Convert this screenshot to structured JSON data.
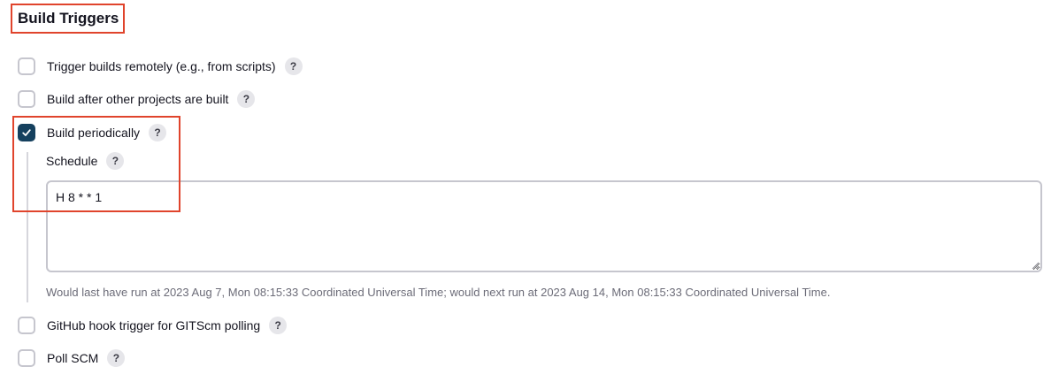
{
  "section": {
    "title": "Build Triggers"
  },
  "triggers": [
    {
      "label": "Trigger builds remotely (e.g., from scripts)",
      "checked": false,
      "help": "?"
    },
    {
      "label": "Build after other projects are built",
      "checked": false,
      "help": "?"
    },
    {
      "label": "Build periodically",
      "checked": true,
      "help": "?"
    },
    {
      "label": "GitHub hook trigger for GITScm polling",
      "checked": false,
      "help": "?"
    },
    {
      "label": "Poll SCM",
      "checked": false,
      "help": "?"
    }
  ],
  "schedule": {
    "label": "Schedule",
    "help": "?",
    "value": "H 8 * * 1",
    "hint": "Would last have run at 2023 Aug 7, Mon 08:15:33 Coordinated Universal Time; would next run at 2023 Aug 14, Mon 08:15:33 Coordinated Universal Time."
  },
  "colors": {
    "checkbox_checked": "#15405e",
    "highlight": "#e0442c",
    "hint_text": "#6c6c78"
  }
}
